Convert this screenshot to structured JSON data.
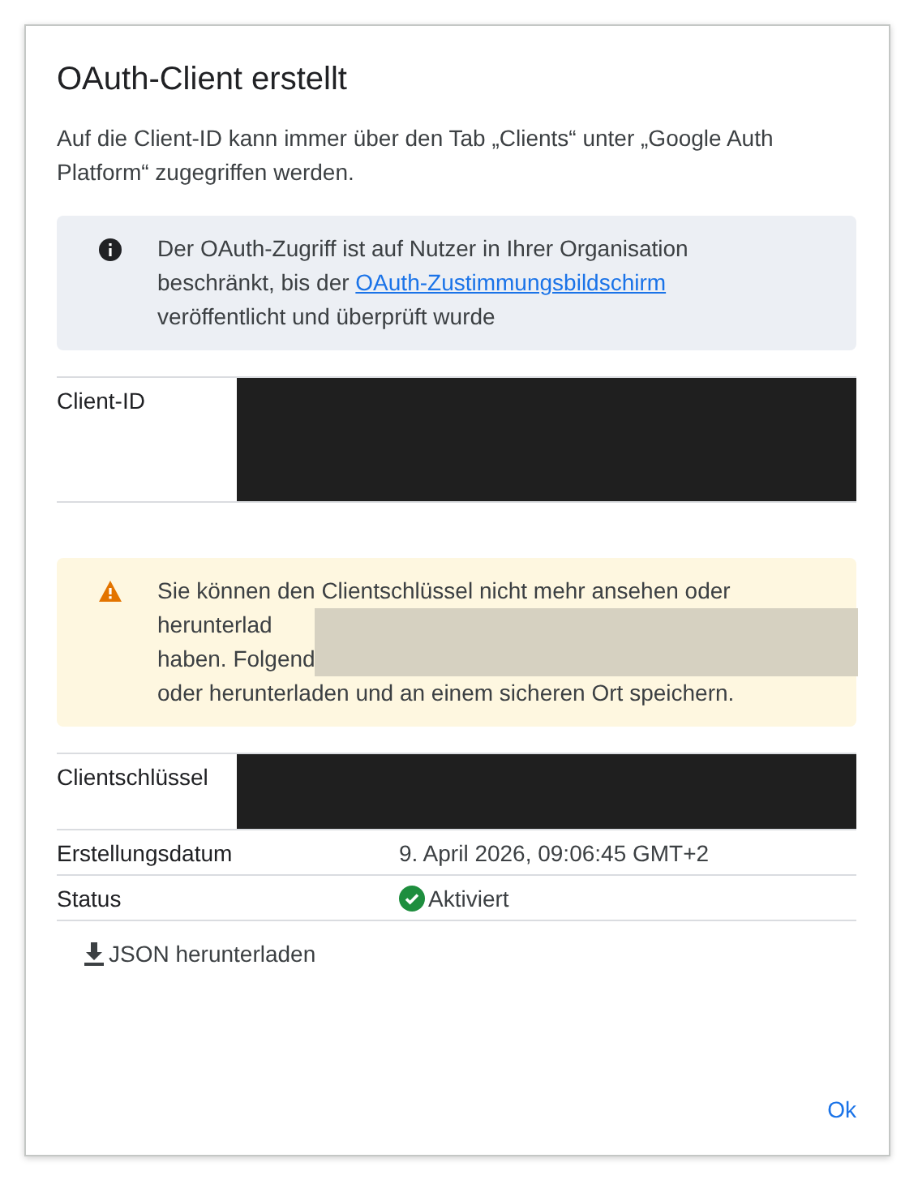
{
  "dialog": {
    "title": "OAuth-Client erstellt",
    "description": "Auf die Client-ID kann immer über den Tab „Clients“ unter „Google Auth Platform“ zugegriffen werden.",
    "info": {
      "kind": "info",
      "before": "Der OAuth-Zugriff ist auf Nutzer in Ihrer Organisation beschränkt, bis der ",
      "link": "OAuth-Zustimmungsbildschirm",
      "after": " veröffentlicht und überprüft wurde"
    },
    "client_id": {
      "label": "Client-ID",
      "redacted": true
    },
    "warning": {
      "kind": "warning",
      "first_line": "Sie können den Clientschlüssel nicht mehr ansehen oder",
      "covered_lines": [
        "herunterlad",
        "haben. Folgend"
      ],
      "last_line": "oder herunterladen und an einem sicheren Ort speichern."
    },
    "details": [
      {
        "label": "Clientschlüssel",
        "kind": "redacted"
      },
      {
        "label": "Erstellungsdatum",
        "kind": "text",
        "value": "9. April 2026, 09:06:45 GMT+2"
      },
      {
        "label": "Status",
        "kind": "status",
        "value": "Aktiviert",
        "active": true
      }
    ],
    "download": "JSON herunterladen",
    "ok": "Ok"
  }
}
